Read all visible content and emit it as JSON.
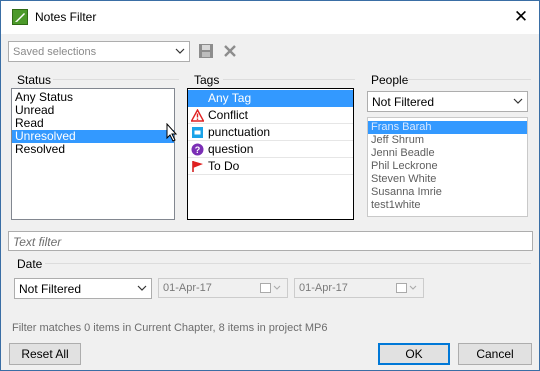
{
  "window": {
    "title": "Notes Filter"
  },
  "saved": {
    "placeholder": "Saved selections"
  },
  "status": {
    "label": "Status",
    "items": [
      "Any Status",
      "Unread",
      "Read",
      "Unresolved",
      "Resolved"
    ],
    "selected_index": 3
  },
  "tags": {
    "label": "Tags",
    "items": [
      {
        "label": "Any Tag",
        "icon": "none"
      },
      {
        "label": "Conflict",
        "icon": "warning-triangle-icon"
      },
      {
        "label": "punctuation",
        "icon": "blue-square-icon"
      },
      {
        "label": "question",
        "icon": "purple-question-icon"
      },
      {
        "label": "To Do",
        "icon": "red-flag-icon"
      }
    ],
    "selected_index": 0
  },
  "people": {
    "label": "People",
    "filter_value": "Not Filtered",
    "items": [
      "Frans Barah",
      "Jeff Shrum",
      "Jenni Beadle",
      "Phil Leckrone",
      "Steven White",
      "Susanna Imrie",
      "test1white"
    ],
    "selected_index": 0
  },
  "text_filter": {
    "placeholder": "Text filter"
  },
  "date": {
    "label": "Date",
    "mode": "Not Filtered",
    "from": "01-Apr-17",
    "to": "01-Apr-17"
  },
  "status_message": "Filter matches 0 items in Current Chapter, 8 items in project MP6",
  "buttons": {
    "reset": "Reset All",
    "ok": "OK",
    "cancel": "Cancel"
  },
  "colors": {
    "selection": "#3399ff",
    "app_icon": "#4c9a2a",
    "default_button_border": "#0078d7"
  }
}
